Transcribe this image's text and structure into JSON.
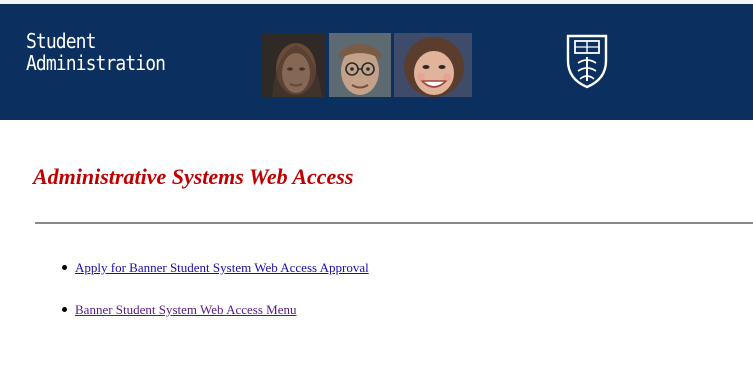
{
  "header": {
    "department_line1": "Student",
    "department_line2": "Administration",
    "photos": [
      "photo-woman-icon",
      "photo-man-icon",
      "photo-smiling-woman-icon"
    ],
    "crest_icon": "university-crest-icon",
    "background_color": "#0b2f5e"
  },
  "main": {
    "title": "Administrative Systems Web Access",
    "title_color": "#c00000",
    "links": [
      {
        "label": "Apply for Banner Student System Web Access Approval",
        "color": "#1a0dab"
      },
      {
        "label": "Banner Student System Web Access Menu",
        "color": "#551a8b"
      }
    ]
  }
}
